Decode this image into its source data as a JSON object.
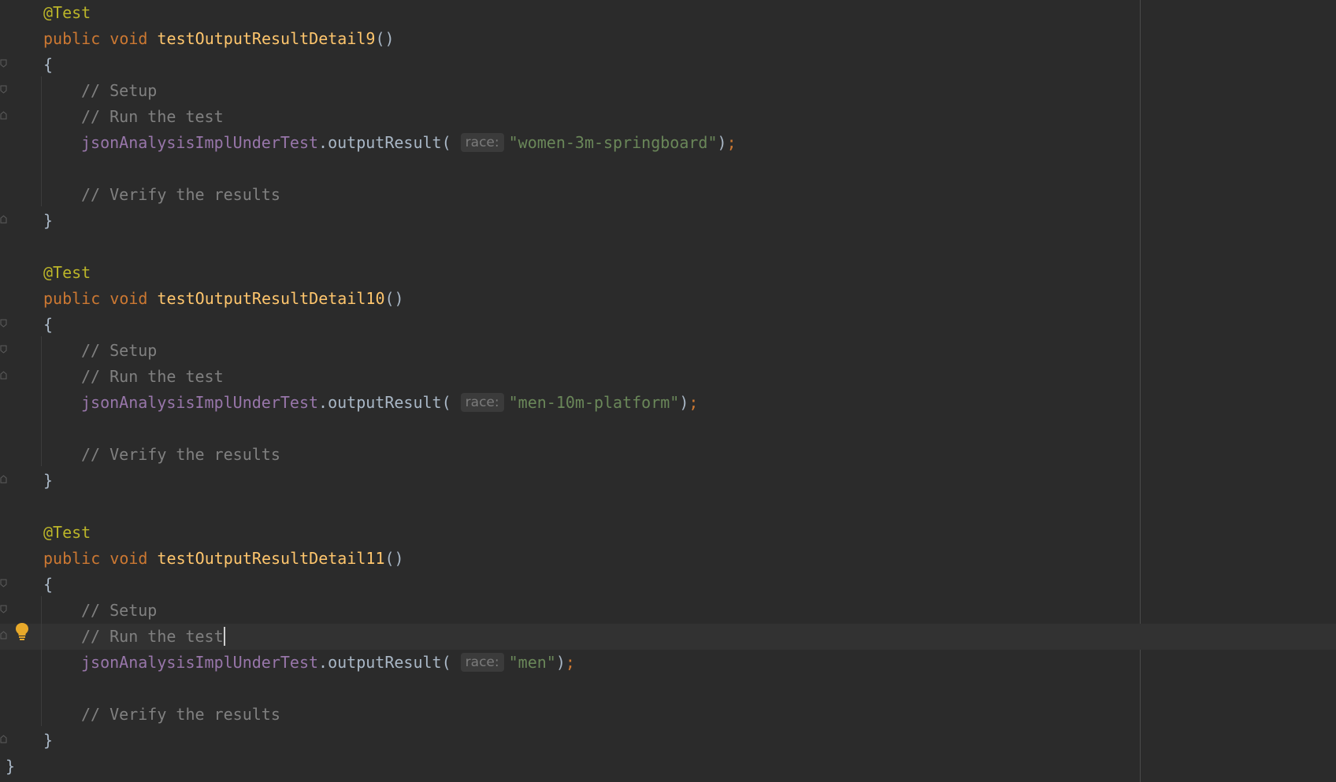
{
  "editor": {
    "blocks": [
      {
        "annotation": "@Test",
        "kw_public": "public",
        "kw_void": "void",
        "method_name": "testOutputResultDetail9",
        "parens": "()",
        "open_brace": "{",
        "comment_setup": "// Setup",
        "comment_run": "// Run the test",
        "receiver": "jsonAnalysisImplUnderTest",
        "call": ".outputResult(",
        "hint": "race:",
        "arg": "\"women-3m-springboard\"",
        "close_paren": ")",
        "semicolon": ";",
        "comment_verify": "// Verify the results",
        "close_brace": "}"
      },
      {
        "annotation": "@Test",
        "kw_public": "public",
        "kw_void": "void",
        "method_name": "testOutputResultDetail10",
        "parens": "()",
        "open_brace": "{",
        "comment_setup": "// Setup",
        "comment_run": "// Run the test",
        "receiver": "jsonAnalysisImplUnderTest",
        "call": ".outputResult(",
        "hint": "race:",
        "arg": "\"men-10m-platform\"",
        "close_paren": ")",
        "semicolon": ";",
        "comment_verify": "// Verify the results",
        "close_brace": "}"
      },
      {
        "annotation": "@Test",
        "kw_public": "public",
        "kw_void": "void",
        "method_name": "testOutputResultDetail11",
        "parens": "()",
        "open_brace": "{",
        "comment_setup": "// Setup",
        "comment_run": "// Run the test",
        "receiver": "jsonAnalysisImplUnderTest",
        "call": ".outputResult(",
        "hint": "race:",
        "arg": "\"men\"",
        "close_paren": ")",
        "semicolon": ";",
        "comment_verify": "// Verify the results",
        "close_brace": "}"
      }
    ],
    "class_close_brace": "}",
    "icons": {
      "intention_bulb": "lightbulb-icon",
      "fold_marker": "fold-marker-icon"
    },
    "colors": {
      "background": "#2b2b2b",
      "current_line": "#323232",
      "annotation": "#bbb529",
      "keyword": "#cc7832",
      "method": "#ffc66d",
      "comment": "#808080",
      "field": "#9876aa",
      "string": "#6a8759",
      "bulb": "#e8a92a"
    }
  }
}
